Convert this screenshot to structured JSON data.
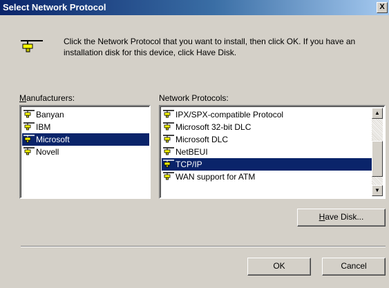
{
  "window": {
    "title": "Select Network Protocol",
    "close_label": "X"
  },
  "description": "Click the Network Protocol that you want to install, then click OK. If you have an installation disk for this device, click Have Disk.",
  "manufacturers": {
    "label": "Manufacturers:",
    "items": [
      "Banyan",
      "IBM",
      "Microsoft",
      "Novell"
    ],
    "selected": "Microsoft"
  },
  "protocols": {
    "label": "Network Protocols:",
    "items": [
      "IPX/SPX-compatible Protocol",
      "Microsoft 32-bit DLC",
      "Microsoft DLC",
      "NetBEUI",
      "TCP/IP",
      "WAN support for ATM"
    ],
    "selected": "TCP/IP"
  },
  "buttons": {
    "have_disk": "Have Disk...",
    "ok": "OK",
    "cancel": "Cancel"
  },
  "icons": {
    "protocol": "network-protocol-icon"
  },
  "colors": {
    "selection": "#0a246a",
    "title_gradient_start": "#0a246a",
    "dialog_face": "#d4d0c8"
  }
}
